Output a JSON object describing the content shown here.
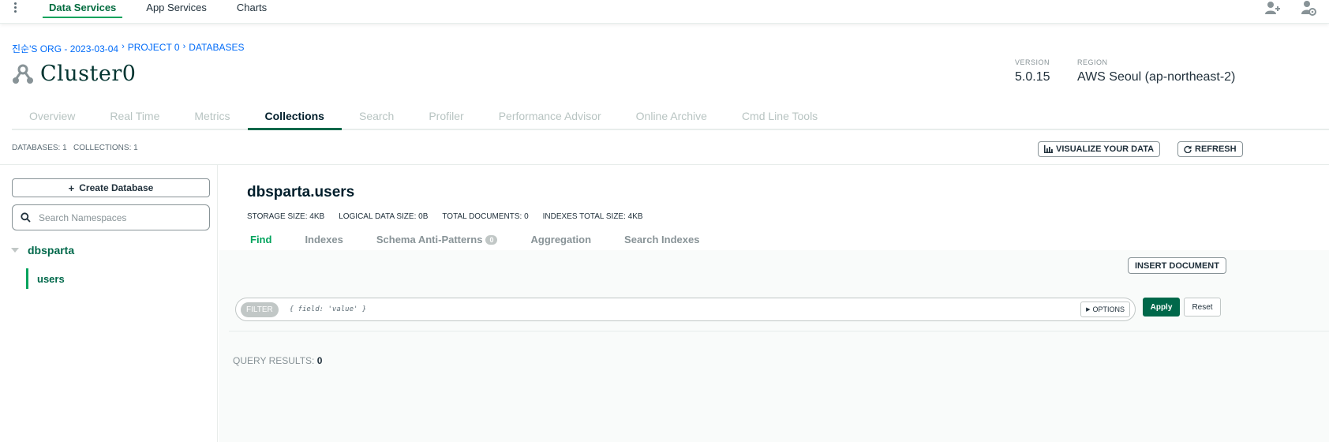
{
  "topnav": {
    "items": [
      {
        "label": "Data Services",
        "active": true
      },
      {
        "label": "App Services",
        "active": false
      },
      {
        "label": "Charts",
        "active": false
      }
    ],
    "icons": [
      "add-user-icon",
      "user-settings-icon"
    ]
  },
  "breadcrumb": {
    "org": "진순'S ORG - 2023-03-04",
    "project": "PROJECT 0",
    "section": "DATABASES",
    "separator": "›"
  },
  "cluster": {
    "name": "Cluster0",
    "version_label": "VERSION",
    "version": "5.0.15",
    "region_label": "REGION",
    "region": "AWS Seoul (ap-northeast-2)"
  },
  "tabs": [
    {
      "label": "Overview",
      "active": false
    },
    {
      "label": "Real Time",
      "active": false
    },
    {
      "label": "Metrics",
      "active": false
    },
    {
      "label": "Collections",
      "active": true
    },
    {
      "label": "Search",
      "active": false
    },
    {
      "label": "Profiler",
      "active": false
    },
    {
      "label": "Performance Advisor",
      "active": false
    },
    {
      "label": "Online Archive",
      "active": false
    },
    {
      "label": "Cmd Line Tools",
      "active": false
    }
  ],
  "stats": {
    "databases": "DATABASES: 1",
    "collections": "COLLECTIONS: 1",
    "visualize_label": "VISUALIZE YOUR DATA",
    "refresh_label": "REFRESH"
  },
  "sidebar": {
    "create_db_label": "Create Database",
    "search_placeholder": "Search Namespaces",
    "database": "dbsparta",
    "collection": "users"
  },
  "collection": {
    "title": "dbsparta.users",
    "storage_size": "STORAGE SIZE: 4KB",
    "logical_size": "LOGICAL DATA SIZE: 0B",
    "total_docs": "TOTAL DOCUMENTS: 0",
    "indexes_size": "INDEXES TOTAL SIZE: 4KB"
  },
  "subtabs": [
    {
      "label": "Find",
      "active": true,
      "badge": ""
    },
    {
      "label": "Indexes",
      "active": false,
      "badge": ""
    },
    {
      "label": "Schema Anti-Patterns",
      "active": false,
      "badge": "0"
    },
    {
      "label": "Aggregation",
      "active": false,
      "badge": ""
    },
    {
      "label": "Search Indexes",
      "active": false,
      "badge": ""
    }
  ],
  "find": {
    "insert_label": "INSERT DOCUMENT",
    "filter_label": "FILTER",
    "filter_placeholder": "{ field: 'value' }",
    "options_label": "OPTIONS",
    "apply_label": "Apply",
    "reset_label": "Reset",
    "query_results_label": "QUERY RESULTS:",
    "query_results_count": "0"
  },
  "colors": {
    "accent_green": "#00684a",
    "link_blue": "#016bf8",
    "active_tab_underline": "#00684a"
  }
}
